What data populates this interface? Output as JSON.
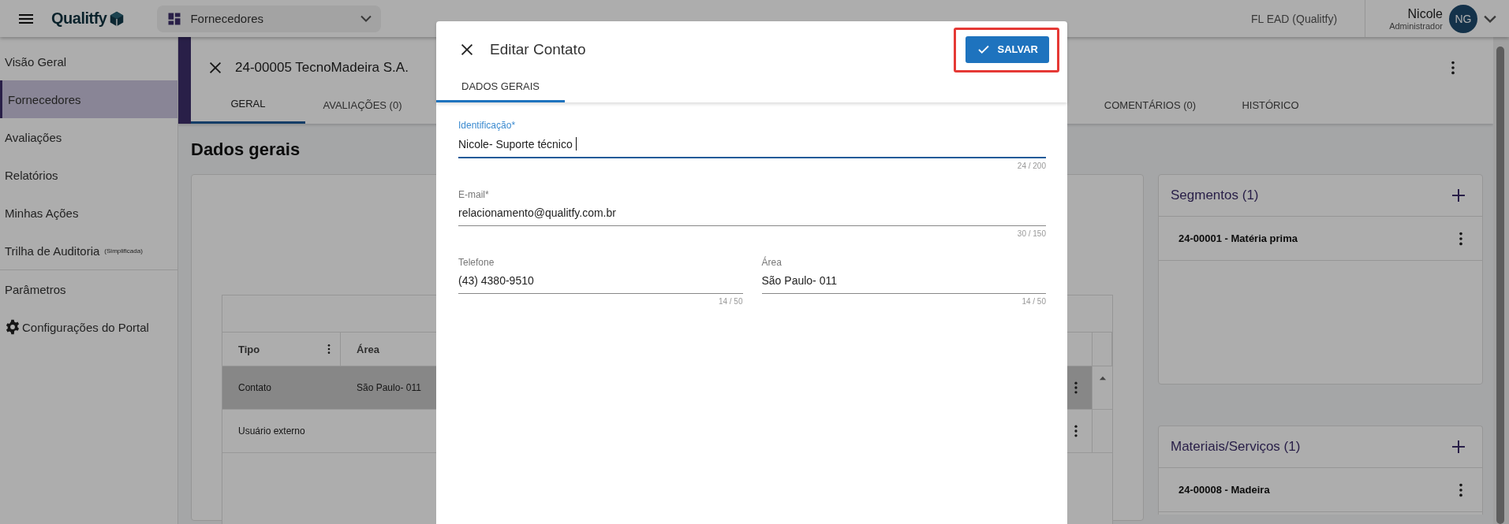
{
  "top_bar": {
    "logo": "Qualitfy",
    "module_selector": "Fornecedores",
    "tenant": "FL EAD (Qualitfy)",
    "user": {
      "name": "Nicole",
      "role": "Administrador",
      "initials": "NG"
    }
  },
  "sidebar": {
    "items": [
      {
        "kind": "link",
        "label": "Visão Geral",
        "selected": false
      },
      {
        "kind": "link",
        "label": "Fornecedores",
        "selected": true
      },
      {
        "kind": "link",
        "label": "Avaliações",
        "selected": false
      },
      {
        "kind": "link",
        "label": "Relatórios",
        "selected": false
      },
      {
        "kind": "link",
        "label": "Minhas Ações",
        "selected": false
      },
      {
        "kind": "link",
        "label": "Trilha de Auditoria",
        "note": "(Simplificada)",
        "selected": false
      },
      {
        "kind": "divider"
      },
      {
        "kind": "link",
        "label": "Parâmetros",
        "selected": false
      },
      {
        "kind": "settings",
        "label": "Configurações do Portal",
        "selected": false
      }
    ]
  },
  "supplier": {
    "title": "24-00005 TecnoMadeira S.A.",
    "tabs": [
      {
        "label": "GERAL",
        "selected": true
      },
      {
        "label": "AVALIAÇÕES (0)",
        "selected": false
      },
      {
        "label": "COMENTÁRIOS (0)",
        "selected": false
      },
      {
        "label": "HISTÓRICO",
        "selected": false
      }
    ],
    "section_title": "Dados gerais",
    "table": {
      "columns": [
        "Tipo",
        "Área"
      ],
      "rows": [
        {
          "cells": [
            "Contato",
            "São Paulo- 011"
          ],
          "selected": true
        },
        {
          "cells": [
            "Usuário externo"
          ],
          "selected": false
        }
      ]
    },
    "panels": [
      {
        "title": "Segmentos (1)",
        "items": [
          "24-00001 - Matéria prima"
        ]
      },
      {
        "title": "Materiais/Serviços (1)",
        "items": [
          "24-00008 - Madeira"
        ]
      }
    ]
  },
  "dialog": {
    "title": "Editar Contato",
    "save_button": {
      "label": "SALVAR",
      "highlighted": true
    },
    "tabs": [
      {
        "label": "DADOS GERAIS",
        "selected": true
      }
    ],
    "field_rows": [
      [
        {
          "label": "Identificação*",
          "value": "Nicole- Suporte técnico",
          "counter": "24 / 200",
          "focused": true
        }
      ],
      [
        {
          "label": "E-mail*",
          "value": "relacionamento@qualitfy.com.br",
          "counter": "30 / 150",
          "focused": false
        }
      ],
      [
        {
          "label": "Telefone",
          "value": "(43) 4380-9510",
          "counter": "14 / 50",
          "focused": false
        },
        {
          "label": "Área",
          "value": "São Paulo- 011",
          "counter": "14 / 50",
          "focused": false
        }
      ]
    ]
  }
}
